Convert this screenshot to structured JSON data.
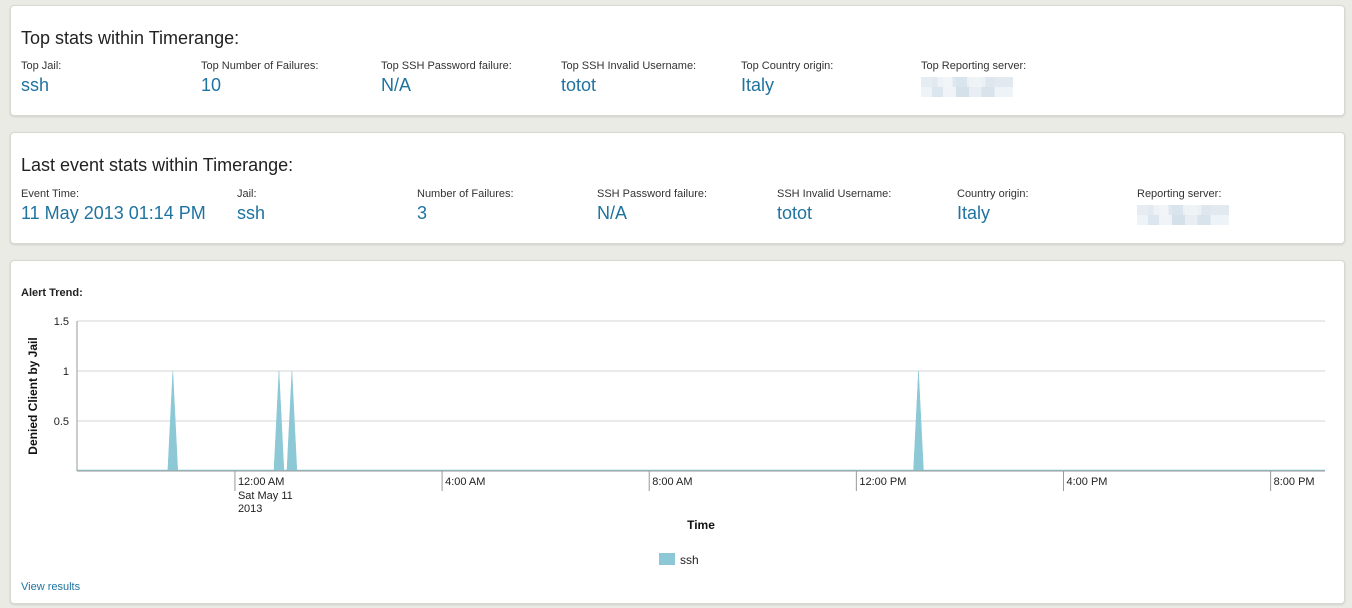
{
  "top_stats": {
    "title": "Top stats within Timerange:",
    "items": [
      {
        "label": "Top Jail:",
        "value": "ssh"
      },
      {
        "label": "Top Number of Failures:",
        "value": "10"
      },
      {
        "label": "Top SSH Password failure:",
        "value": "N/A"
      },
      {
        "label": "Top SSH Invalid Username:",
        "value": "totot"
      },
      {
        "label": "Top Country origin:",
        "value": "Italy"
      },
      {
        "label": "Top Reporting server:",
        "value": ""
      }
    ]
  },
  "last_event": {
    "title": "Last event stats within Timerange:",
    "items": [
      {
        "label": "Event Time:",
        "value": "11 May 2013 01:14 PM"
      },
      {
        "label": "Jail:",
        "value": "ssh"
      },
      {
        "label": "Number of Failures:",
        "value": "3"
      },
      {
        "label": "SSH Password failure:",
        "value": "N/A"
      },
      {
        "label": "SSH Invalid Username:",
        "value": "totot"
      },
      {
        "label": "Country origin:",
        "value": "Italy"
      },
      {
        "label": "Reporting server:",
        "value": ""
      }
    ]
  },
  "alert_trend": {
    "title": "Alert Trend:",
    "view_results_label": "View results"
  },
  "chart_data": {
    "type": "area",
    "title": "",
    "xlabel": "Time",
    "ylabel": "Denied Client by Jail",
    "ylim": [
      0,
      1.5
    ],
    "y_ticks": [
      "0.5",
      "1",
      "1.5"
    ],
    "x_ticks": [
      {
        "label": "12:00 AM",
        "sub": [
          "Sat May 11",
          "2013"
        ]
      },
      {
        "label": "4:00 AM",
        "sub": []
      },
      {
        "label": "8:00 AM",
        "sub": []
      },
      {
        "label": "12:00 PM",
        "sub": []
      },
      {
        "label": "4:00 PM",
        "sub": []
      },
      {
        "label": "8:00 PM",
        "sub": []
      }
    ],
    "x_tick_hours": [
      0,
      4,
      8,
      12,
      16,
      20
    ],
    "xlim_hours": [
      -3.05,
      21.05
    ],
    "series": [
      {
        "name": "ssh",
        "color": "#8cc8d6",
        "spikes_hours": [
          -1.2,
          0.85,
          1.1,
          13.2
        ],
        "values": [
          1,
          1,
          1,
          1
        ]
      }
    ],
    "grid": true,
    "legend": "bottom-center"
  }
}
